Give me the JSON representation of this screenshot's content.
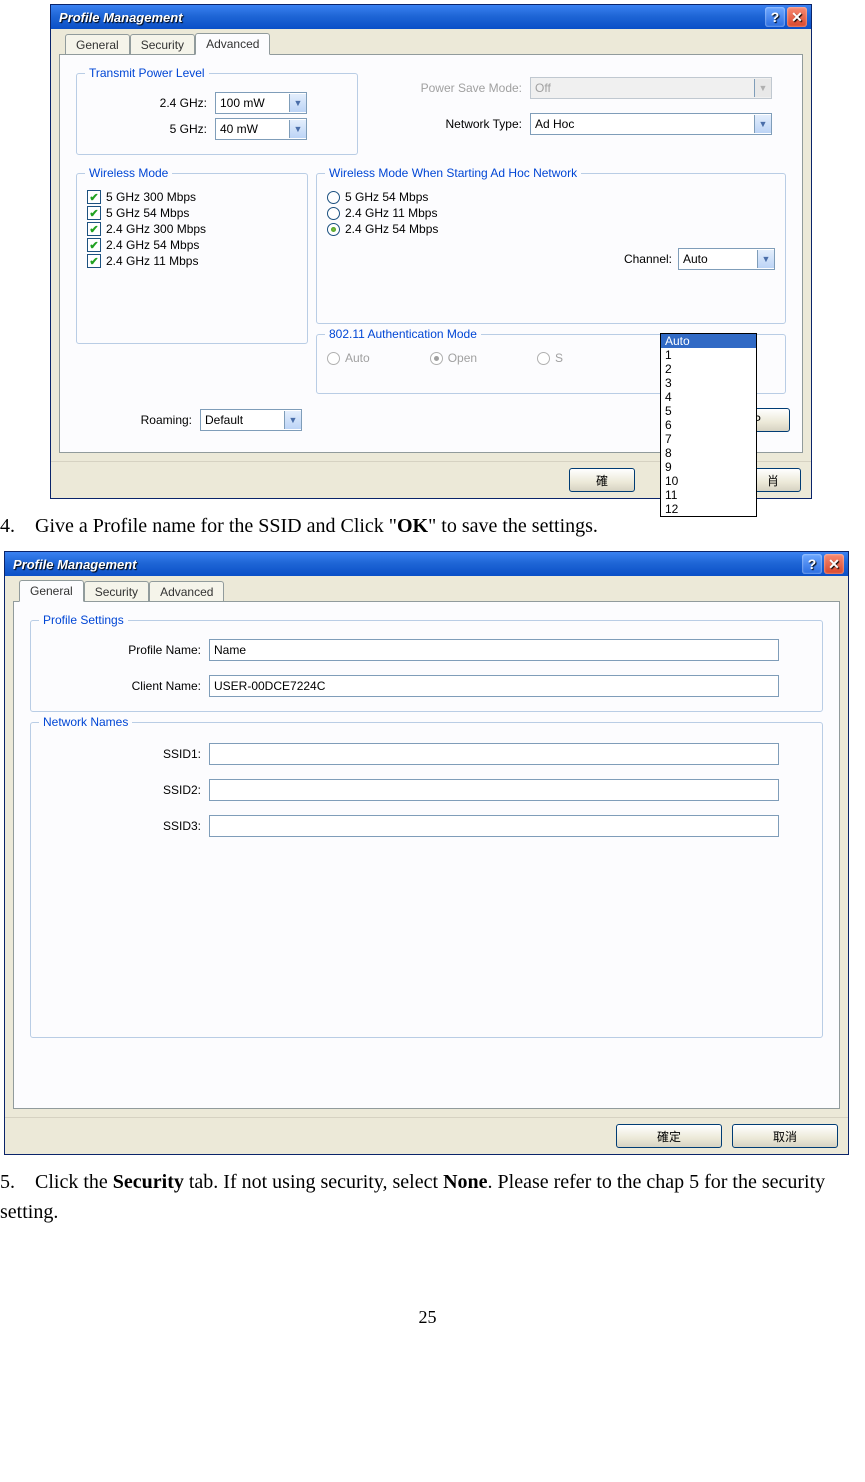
{
  "win1": {
    "title": "Profile Management",
    "tabs": {
      "general": "General",
      "security": "Security",
      "advanced": "Advanced"
    },
    "tpl": {
      "legend": "Transmit Power Level",
      "l24": "2.4 GHz:",
      "v24": "100 mW",
      "l5": "5 GHz:",
      "v5": "40 mW"
    },
    "psm": {
      "label": "Power Save Mode:",
      "value": "Off"
    },
    "nt": {
      "label": "Network Type:",
      "value": "Ad Hoc"
    },
    "wm": {
      "legend": "Wireless Mode",
      "items": [
        "5 GHz 300 Mbps",
        "5 GHz 54 Mbps",
        "2.4 GHz 300 Mbps",
        "2.4 GHz 54 Mbps",
        "2.4 GHz 11 Mbps"
      ]
    },
    "wmah": {
      "legend": "Wireless Mode When Starting Ad Hoc Network",
      "items": [
        "5 GHz 54 Mbps",
        "2.4 GHz 11 Mbps",
        "2.4 GHz 54 Mbps"
      ],
      "selected": 2,
      "channelLabel": "Channel:",
      "channelValue": "Auto",
      "channelOptions": [
        "Auto",
        "1",
        "2",
        "3",
        "4",
        "5",
        "6",
        "7",
        "8",
        "9",
        "10",
        "11",
        "12"
      ]
    },
    "auth": {
      "legend": "802.11 Authentication Mode",
      "items": [
        "Auto",
        "Open",
        "S"
      ],
      "selected": 1
    },
    "roaming": {
      "label": "Roaming:",
      "value": "Default"
    },
    "buttons": {
      "ok": "確",
      "cancel": "肖",
      "p": "P"
    }
  },
  "step4": {
    "num": "4.",
    "text_a": "Give a Profile name for the SSID and Click \"",
    "bold": "OK",
    "text_b": "\" to save the settings."
  },
  "win2": {
    "title": "Profile Management",
    "tabs": {
      "general": "General",
      "security": "Security",
      "advanced": "Advanced"
    },
    "ps": {
      "legend": "Profile Settings",
      "pn_label": "Profile Name:",
      "pn_value": "Name",
      "cn_label": "Client Name:",
      "cn_value": "USER-00DCE7224C"
    },
    "nn": {
      "legend": "Network Names",
      "s1": "SSID1:",
      "s2": "SSID2:",
      "s3": "SSID3:"
    },
    "buttons": {
      "ok": "確定",
      "cancel": "取消"
    }
  },
  "step5": {
    "num": "5.",
    "a": "Click the ",
    "b": "Security",
    "c": " tab. If not using security, select ",
    "d": "None",
    "e": ". Please refer to the chap 5 for the security setting."
  },
  "pageNumber": "25"
}
